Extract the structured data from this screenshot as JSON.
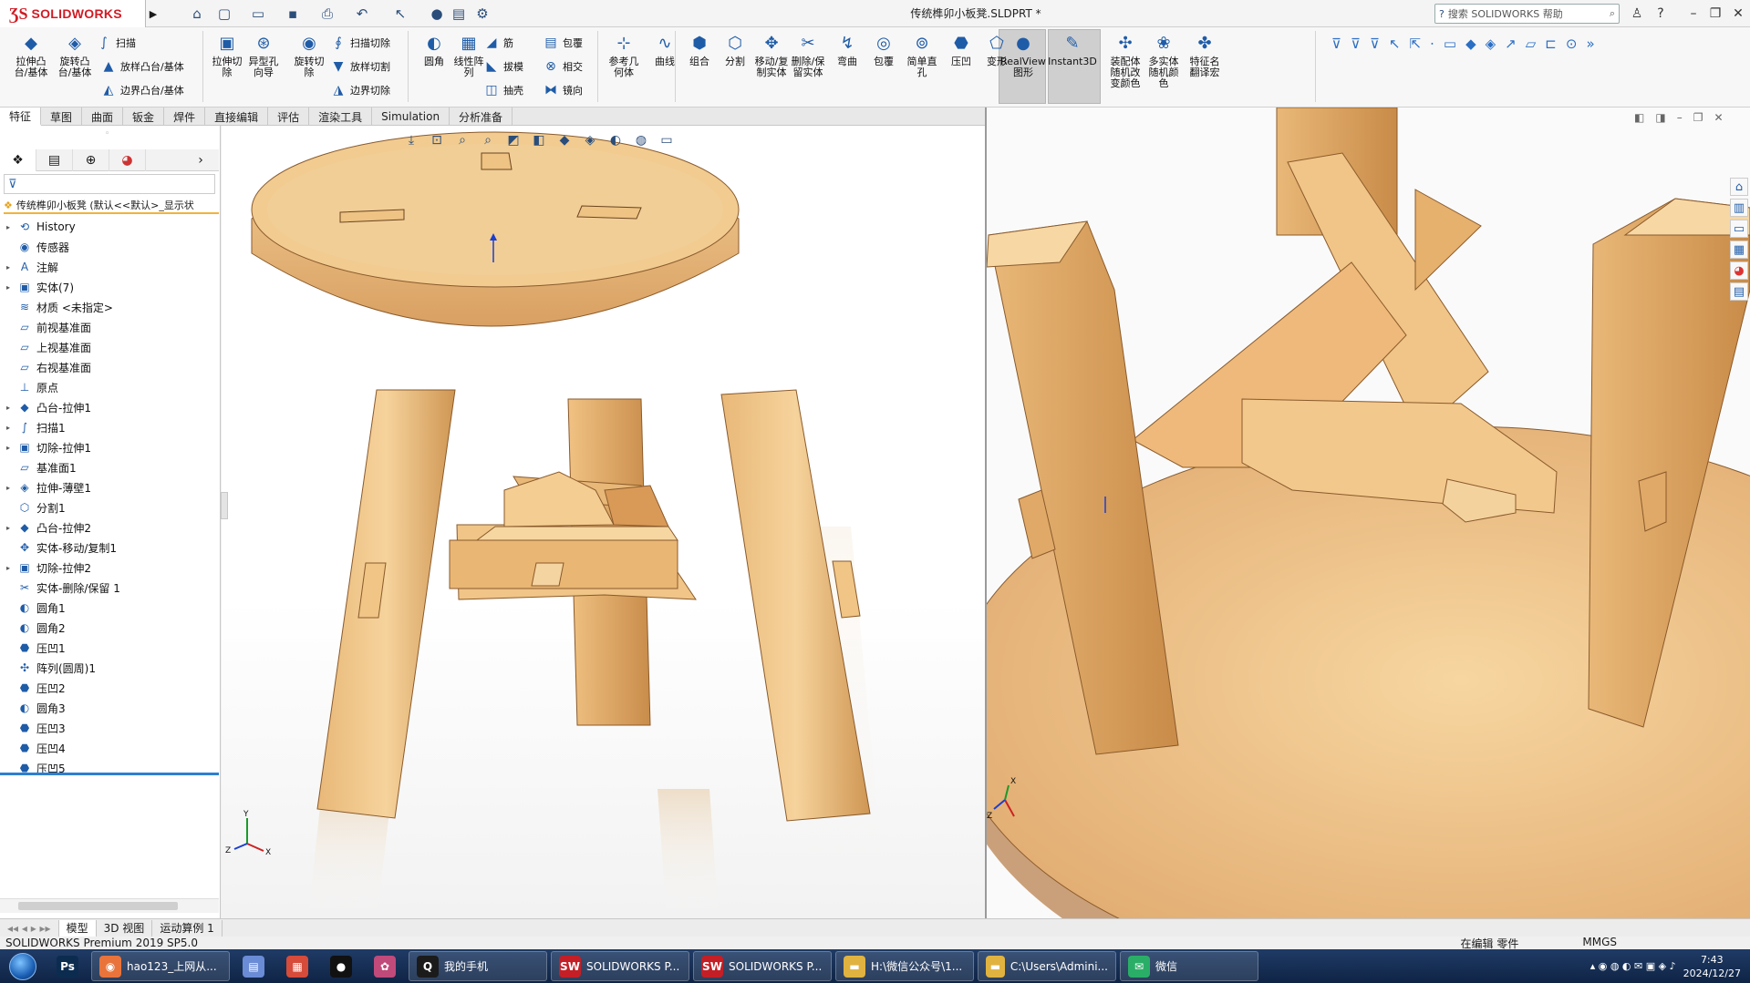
{
  "titlebar": {
    "logo_ds": "ƷS",
    "logo_text": "SOLIDWORKS",
    "doc_title": "传统榫卯小板凳.SLDPRT *",
    "search_placeholder": "搜索 SOLIDWORKS 帮助",
    "quick_icons": [
      "home-icon",
      "new-icon",
      "open-icon",
      "save-icon",
      "print-icon",
      "undo-icon",
      "select-icon",
      "rebuild-icon",
      "file-props-icon",
      "options-icon"
    ]
  },
  "commands": {
    "large": [
      {
        "name": "extrude-boss",
        "label": "拉伸凸\n台/基体",
        "icon": "◆"
      },
      {
        "name": "revolve-boss",
        "label": "旋转凸\n台/基体",
        "icon": "◈"
      },
      {
        "name": "extrude-cut",
        "label": "拉伸切\n除",
        "icon": "▣"
      },
      {
        "name": "hole-wizard",
        "label": "异型孔\n向导",
        "icon": "⊛"
      },
      {
        "name": "revolve-cut",
        "label": "旋转切\n除",
        "icon": "◉"
      },
      {
        "name": "fillet",
        "label": "圆角",
        "icon": "◐"
      },
      {
        "name": "linear-pattern",
        "label": "线性阵\n列",
        "icon": "▦"
      },
      {
        "name": "ref-geometry",
        "label": "参考几\n何体",
        "icon": "⊹"
      },
      {
        "name": "curves",
        "label": "曲线",
        "icon": "∿"
      },
      {
        "name": "combine",
        "label": "组合",
        "icon": "⬢"
      },
      {
        "name": "split",
        "label": "分割",
        "icon": "⬡"
      },
      {
        "name": "move-copy-body",
        "label": "移动/复\n制实体",
        "icon": "✥"
      },
      {
        "name": "delete-keep-body",
        "label": "删除/保\n留实体",
        "icon": "✂"
      },
      {
        "name": "flex",
        "label": "弯曲",
        "icon": "↯"
      },
      {
        "name": "wrap",
        "label": "包覆",
        "icon": "◎"
      },
      {
        "name": "simple-hole",
        "label": "简单直\n孔",
        "icon": "⊚"
      },
      {
        "name": "indent",
        "label": "压凹",
        "icon": "⬣"
      },
      {
        "name": "deform",
        "label": "变形",
        "icon": "⬠"
      },
      {
        "name": "realview",
        "label": "RealView\n图形",
        "icon": "●"
      },
      {
        "name": "instant3d",
        "label": "Instant3D",
        "icon": "✎"
      },
      {
        "name": "random-color",
        "label": "装配体\n随机改\n变颜色",
        "icon": "✣"
      },
      {
        "name": "multibody-color",
        "label": "多实体\n随机颜\n色",
        "icon": "❀"
      },
      {
        "name": "feature-translate",
        "label": "特征名\n翻译宏",
        "icon": "✤"
      }
    ],
    "small": [
      {
        "name": "sweep",
        "label": "扫描",
        "icon": "∫"
      },
      {
        "name": "loft",
        "label": "放样凸台/基体",
        "icon": "▲"
      },
      {
        "name": "boundary-boss",
        "label": "边界凸台/基体",
        "icon": "◭"
      },
      {
        "name": "sweep-cut",
        "label": "扫描切除",
        "icon": "∮"
      },
      {
        "name": "loft-cut",
        "label": "放样切割",
        "icon": "▼"
      },
      {
        "name": "boundary-cut",
        "label": "边界切除",
        "icon": "◮"
      },
      {
        "name": "rib",
        "label": "筋",
        "icon": "◢"
      },
      {
        "name": "draft",
        "label": "拔模",
        "icon": "◣"
      },
      {
        "name": "shell",
        "label": "抽壳",
        "icon": "◫"
      },
      {
        "name": "wrap2",
        "label": "包覆",
        "icon": "▤"
      },
      {
        "name": "intersect",
        "label": "相交",
        "icon": "⊗"
      },
      {
        "name": "mirror",
        "label": "镜向",
        "icon": "⧓"
      }
    ]
  },
  "tabs": [
    "特征",
    "草图",
    "曲面",
    "钣金",
    "焊件",
    "直接编辑",
    "评估",
    "渲染工具",
    "Simulation",
    "分析准备"
  ],
  "feature_manager": {
    "root": "传统榫卯小板凳 (默认<<默认>_显示状",
    "items": [
      {
        "label": "History",
        "icon": "⟲",
        "exp": "▸"
      },
      {
        "label": "传感器",
        "icon": "◉",
        "exp": ""
      },
      {
        "label": "注解",
        "icon": "A",
        "exp": "▸"
      },
      {
        "label": "实体(7)",
        "icon": "▣",
        "exp": "▸"
      },
      {
        "label": "材质 <未指定>",
        "icon": "≋",
        "exp": ""
      },
      {
        "label": "前视基准面",
        "icon": "▱",
        "exp": ""
      },
      {
        "label": "上视基准面",
        "icon": "▱",
        "exp": ""
      },
      {
        "label": "右视基准面",
        "icon": "▱",
        "exp": ""
      },
      {
        "label": "原点",
        "icon": "⊥",
        "exp": ""
      },
      {
        "label": "凸台-拉伸1",
        "icon": "◆",
        "exp": "▸"
      },
      {
        "label": "扫描1",
        "icon": "∫",
        "exp": "▸"
      },
      {
        "label": "切除-拉伸1",
        "icon": "▣",
        "exp": "▸"
      },
      {
        "label": "基准面1",
        "icon": "▱",
        "exp": ""
      },
      {
        "label": "拉伸-薄壁1",
        "icon": "◈",
        "exp": "▸"
      },
      {
        "label": "分割1",
        "icon": "⬡",
        "exp": ""
      },
      {
        "label": "凸台-拉伸2",
        "icon": "◆",
        "exp": "▸"
      },
      {
        "label": "实体-移动/复制1",
        "icon": "✥",
        "exp": ""
      },
      {
        "label": "切除-拉伸2",
        "icon": "▣",
        "exp": "▸"
      },
      {
        "label": "实体-删除/保留 1",
        "icon": "✂",
        "exp": ""
      },
      {
        "label": "圆角1",
        "icon": "◐",
        "exp": ""
      },
      {
        "label": "圆角2",
        "icon": "◐",
        "exp": ""
      },
      {
        "label": "压凹1",
        "icon": "⬣",
        "exp": ""
      },
      {
        "label": "阵列(圆周)1",
        "icon": "✣",
        "exp": ""
      },
      {
        "label": "压凹2",
        "icon": "⬣",
        "exp": ""
      },
      {
        "label": "圆角3",
        "icon": "◐",
        "exp": ""
      },
      {
        "label": "压凹3",
        "icon": "⬣",
        "exp": ""
      },
      {
        "label": "压凹4",
        "icon": "⬣",
        "exp": ""
      },
      {
        "label": "压凹5",
        "icon": "⬣",
        "exp": ""
      }
    ]
  },
  "model_tabs": [
    "模型",
    "3D 视图",
    "运动算例 1"
  ],
  "status": {
    "left": "SOLIDWORKS Premium 2019 SP5.0",
    "editing": "在编辑 零件",
    "units": "MMGS"
  },
  "taskbar": {
    "items": [
      {
        "name": "photoshop",
        "label": "",
        "icon": "Ps",
        "color": "#0b2c4f",
        "wide": false
      },
      {
        "name": "browser",
        "label": "hao123_上网从...",
        "icon": "◉",
        "color": "#e8743b",
        "wide": true
      },
      {
        "name": "app-a",
        "label": "",
        "icon": "▤",
        "color": "#6a8bd6",
        "wide": false
      },
      {
        "name": "app-b",
        "label": "",
        "icon": "▦",
        "color": "#d64b3a",
        "wide": false
      },
      {
        "name": "recorder",
        "label": "",
        "icon": "●",
        "color": "#111111",
        "wide": false
      },
      {
        "name": "app-c",
        "label": "",
        "icon": "✿",
        "color": "#c04a7a",
        "wide": false
      },
      {
        "name": "qq",
        "label": "我的手机",
        "icon": "Q",
        "color": "#1b1b1b",
        "wide": true
      },
      {
        "name": "sw1",
        "label": "SOLIDWORKS P...",
        "icon": "SW",
        "color": "#c41f26",
        "wide": true
      },
      {
        "name": "sw2",
        "label": "SOLIDWORKS P...",
        "icon": "SW",
        "color": "#c41f26",
        "wide": true
      },
      {
        "name": "folder1",
        "label": "H:\\微信公众号\\1...",
        "icon": "▬",
        "color": "#e0b340",
        "wide": true
      },
      {
        "name": "folder2",
        "label": "C:\\Users\\Admini...",
        "icon": "▬",
        "color": "#e0b340",
        "wide": true
      },
      {
        "name": "wechat",
        "label": "微信",
        "icon": "✉",
        "color": "#2aae67",
        "wide": true
      }
    ],
    "time": "7:43",
    "date": "2024/12/27"
  },
  "colors": {
    "wood_light": "#f2c98d",
    "wood_mid": "#e0a865",
    "wood_dark": "#b97a3c",
    "accent": "#1f5ca8"
  }
}
